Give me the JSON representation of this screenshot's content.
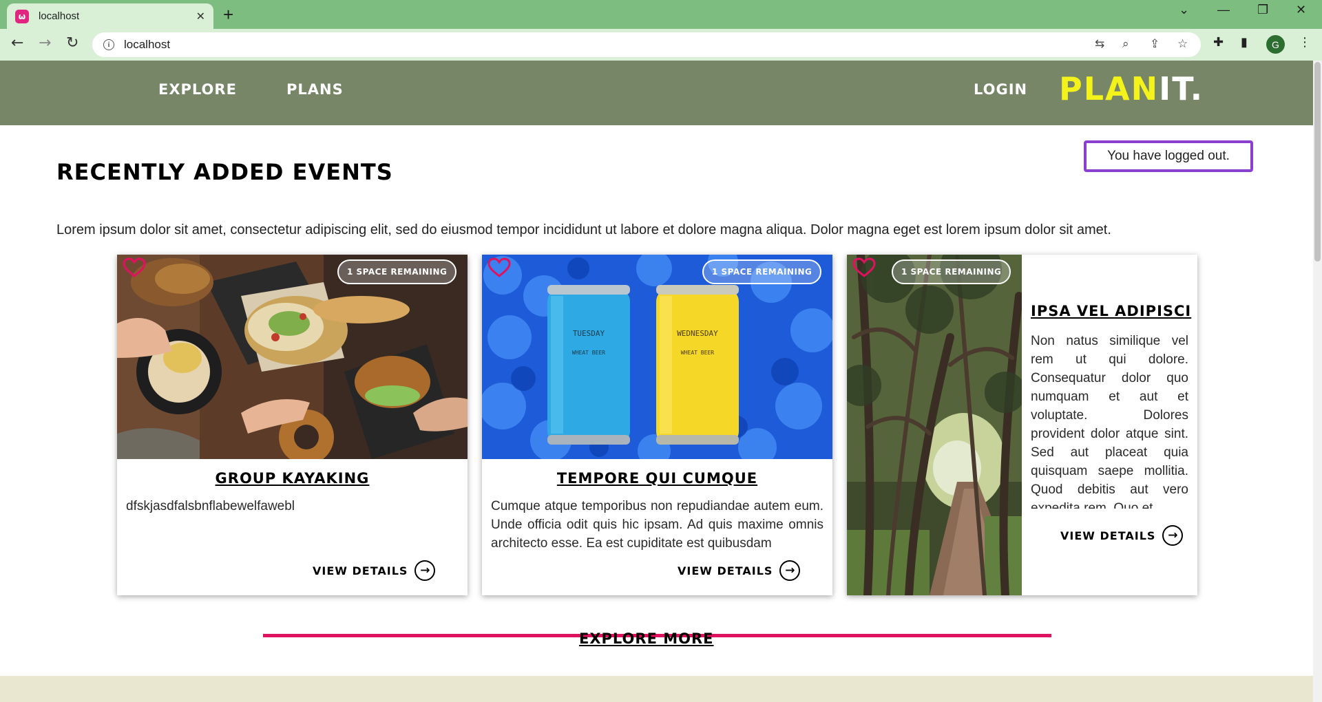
{
  "browser": {
    "tab_title": "localhost",
    "favicon_text": "ω",
    "url": "localhost",
    "profile_initial": "G"
  },
  "nav": {
    "explore": "EXPLORE",
    "plans": "PLANS",
    "login": "LOGIN",
    "logo_part1": "PLAN",
    "logo_part2": "IT."
  },
  "flash_message": "You have logged out.",
  "page": {
    "heading": "RECENTLY ADDED EVENTS",
    "intro": "Lorem ipsum dolor sit amet, consectetur adipiscing elit, sed do eiusmod tempor incididunt ut labore et dolore magna aliqua. Dolor magna eget est lorem ipsum dolor sit amet."
  },
  "events": [
    {
      "title": "GROUP KAYAKING",
      "badge": "1 SPACE REMAINING",
      "description": "dfskjasdfalsbnflabewelfawebl",
      "cta": "VIEW DETAILS",
      "image": "food-platter-photo"
    },
    {
      "title": "TEMPORE QUI CUMQUE",
      "badge": "1 SPACE REMAINING",
      "description": "Cumque atque temporibus non repudiandae autem eum. Unde officia odit quis hic ipsam. Ad quis maxime omnis architecto esse. Ea est cupiditate est quibusdam",
      "cta": "VIEW DETAILS",
      "image": "beer-cans-photo",
      "can_left": "TUESDAY",
      "can_right": "WEDNESDAY",
      "can_sub": "WHEAT BEER"
    },
    {
      "title": "IPSA VEL ADIPISCI",
      "badge": "1 SPACE REMAINING",
      "description": "Non natus similique vel rem ut qui dolore. Consequatur dolor quo numquam et aut et voluptate. Dolores provident dolor atque sint. Sed aut placeat quia quisquam saepe mollitia. Quod debitis aut vero expedita rem. Quo et",
      "cta": "VIEW DETAILS",
      "image": "forest-path-photo"
    }
  ],
  "explore_more": "EXPLORE MORE",
  "colors": {
    "header_bg": "#768667",
    "logo_yellow": "#f4f21b",
    "accent_pink": "#e0125f",
    "flash_border": "#8a3fd1",
    "footer_bg": "#e9e7cf"
  }
}
